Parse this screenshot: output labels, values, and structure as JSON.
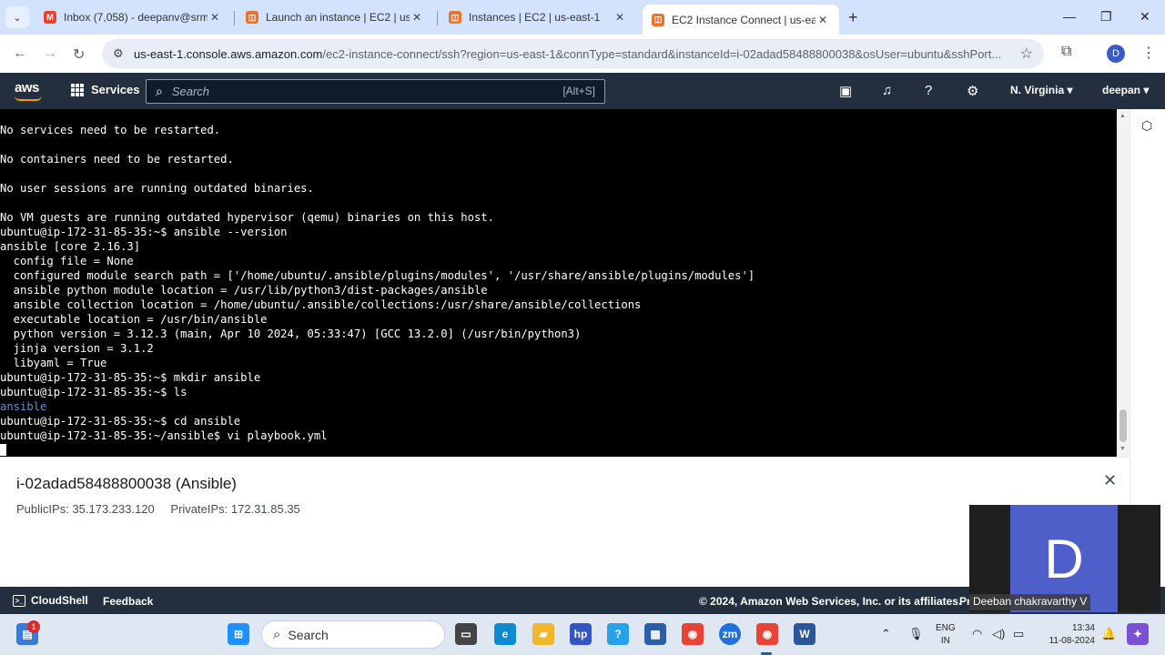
{
  "browser": {
    "tabs": [
      {
        "title": "Inbox (7,058) - deepanv@srmis",
        "favicon": "gmail-icon",
        "active": false
      },
      {
        "title": "Launch an instance | EC2 | us-e",
        "favicon": "aws-ec2-icon",
        "active": false
      },
      {
        "title": "Instances | EC2 | us-east-1",
        "favicon": "aws-ec2-icon",
        "active": false
      },
      {
        "title": "EC2 Instance Connect | us-east-",
        "favicon": "aws-ec2-icon",
        "active": true
      }
    ],
    "url_host": "us-east-1.console.aws.amazon.com",
    "url_path": "/ec2-instance-connect/ssh?region=us-east-1&connType=standard&instanceId=i-02adad58488800038&osUser=ubuntu&sshPort...",
    "profile_initial": "D"
  },
  "aws_nav": {
    "logo": "aws",
    "services_label": "Services",
    "search_placeholder": "Search",
    "search_shortcut": "[Alt+S]",
    "region": "N. Virginia ▾",
    "user": "deepan ▾"
  },
  "terminal": {
    "lines": [
      {
        "text": "No services need to be restarted.",
        "color": "#ffffff"
      },
      {
        "text": "",
        "color": "#ffffff"
      },
      {
        "text": "No containers need to be restarted.",
        "color": "#ffffff"
      },
      {
        "text": "",
        "color": "#ffffff"
      },
      {
        "text": "No user sessions are running outdated binaries.",
        "color": "#ffffff"
      },
      {
        "text": "",
        "color": "#ffffff"
      },
      {
        "text": "No VM guests are running outdated hypervisor (qemu) binaries on this host.",
        "color": "#ffffff"
      },
      {
        "text": "ubuntu@ip-172-31-85-35:~$ ansible --version",
        "color": "#ffffff"
      },
      {
        "text": "ansible [core 2.16.3]",
        "color": "#ffffff"
      },
      {
        "text": "  config file = None",
        "color": "#ffffff"
      },
      {
        "text": "  configured module search path = ['/home/ubuntu/.ansible/plugins/modules', '/usr/share/ansible/plugins/modules']",
        "color": "#ffffff"
      },
      {
        "text": "  ansible python module location = /usr/lib/python3/dist-packages/ansible",
        "color": "#ffffff"
      },
      {
        "text": "  ansible collection location = /home/ubuntu/.ansible/collections:/usr/share/ansible/collections",
        "color": "#ffffff"
      },
      {
        "text": "  executable location = /usr/bin/ansible",
        "color": "#ffffff"
      },
      {
        "text": "  python version = 3.12.3 (main, Apr 10 2024, 05:33:47) [GCC 13.2.0] (/usr/bin/python3)",
        "color": "#ffffff"
      },
      {
        "text": "  jinja version = 3.1.2",
        "color": "#ffffff"
      },
      {
        "text": "  libyaml = True",
        "color": "#ffffff"
      },
      {
        "text": "ubuntu@ip-172-31-85-35:~$ mkdir ansible",
        "color": "#ffffff"
      },
      {
        "text": "ubuntu@ip-172-31-85-35:~$ ls",
        "color": "#ffffff"
      },
      {
        "text": "ansible",
        "color": "#6c8fd8"
      },
      {
        "text": "ubuntu@ip-172-31-85-35:~$ cd ansible",
        "color": "#ffffff"
      },
      {
        "text": "ubuntu@ip-172-31-85-35:~/ansible$ vi playbook.yml",
        "color": "#ffffff"
      }
    ]
  },
  "instance": {
    "title": "i-02adad58488800038 (Ansible)",
    "public_ips": "PublicIPs: 35.173.233.120",
    "private_ips": "PrivateIPs: 172.31.85.35"
  },
  "footer": {
    "cloudshell": "CloudShell",
    "feedback": "Feedback",
    "copyright": "© 2024, Amazon Web Services, Inc. or its affiliates.",
    "privacy": "Pr"
  },
  "video": {
    "initial": "D",
    "name": "Deeban chakravarthy V"
  },
  "taskbar": {
    "search_placeholder": "Search",
    "mail_badge": "1",
    "lang_line1": "ENG",
    "lang_line2": "IN",
    "time": "13:34",
    "date": "11-08-2024"
  }
}
